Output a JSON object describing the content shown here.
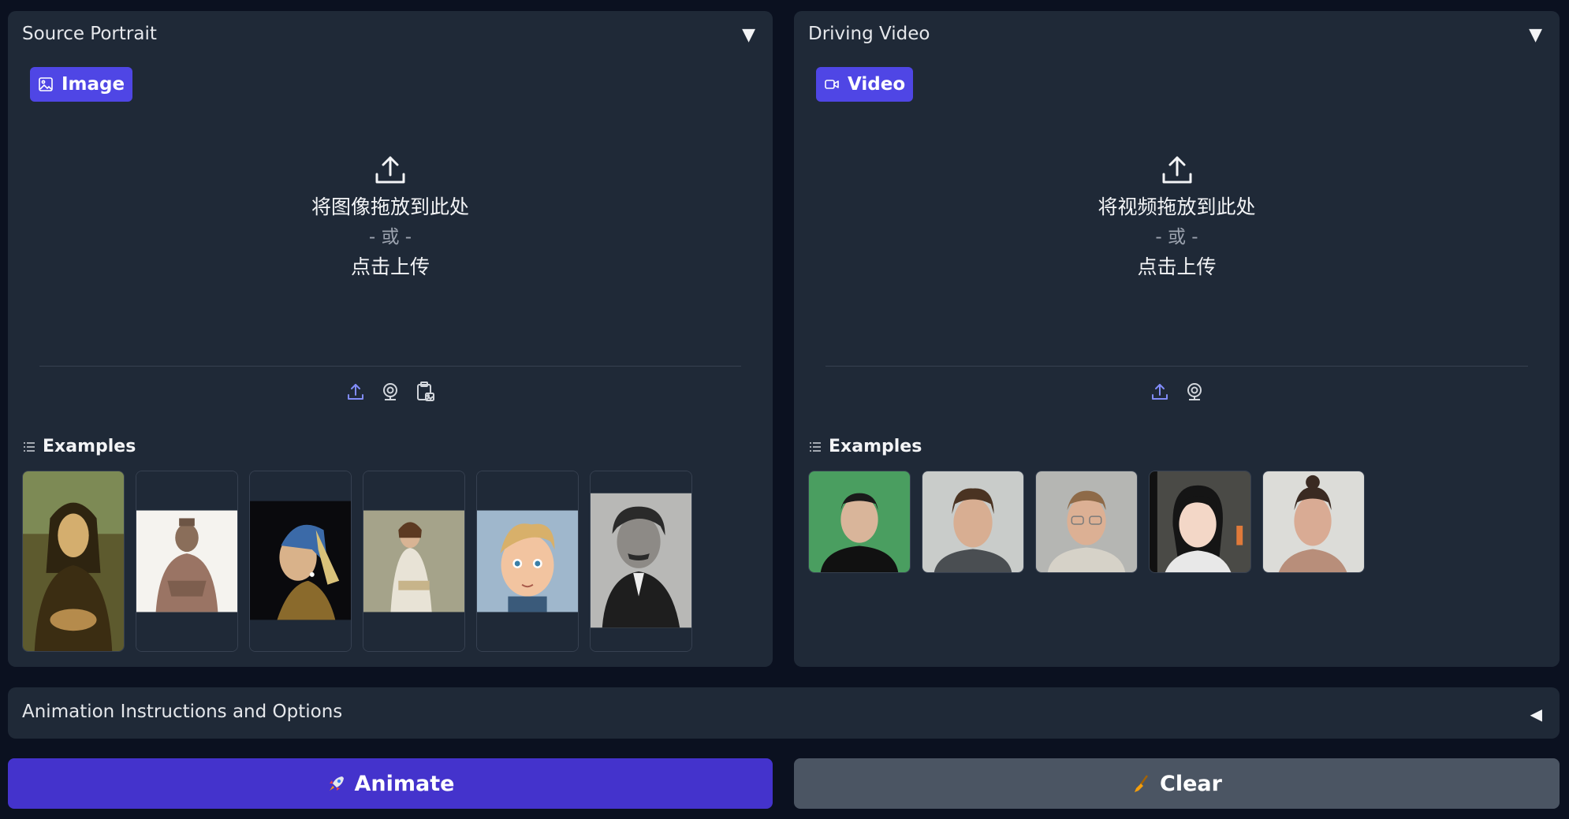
{
  "source": {
    "title": "Source Portrait",
    "badge": "Image",
    "drop_main": "将图像拖放到此处",
    "drop_or": "- 或 -",
    "drop_click": "点击上传",
    "examples_label": "Examples"
  },
  "driving": {
    "title": "Driving Video",
    "badge": "Video",
    "drop_main": "将视频拖放到此处",
    "drop_or": "- 或 -",
    "drop_click": "点击上传",
    "examples_label": "Examples"
  },
  "options": {
    "title": "Animation Instructions and Options"
  },
  "buttons": {
    "animate": "Animate",
    "clear": "Clear"
  },
  "colors": {
    "primary": "#4f46e5",
    "animate": "#4433cc",
    "secondary": "#4b5563",
    "panel": "#1f2937",
    "background": "#0b1120"
  }
}
